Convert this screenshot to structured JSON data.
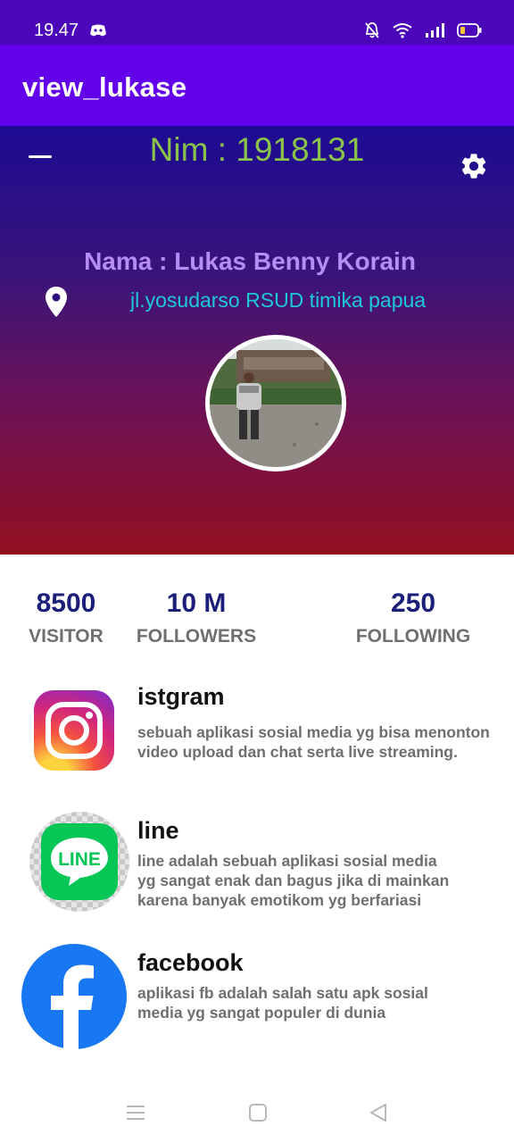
{
  "status_bar": {
    "time": "19.47",
    "icons": [
      "discord-icon",
      "silent-bell-icon",
      "wifi-icon",
      "signal-icon",
      "battery-icon"
    ]
  },
  "app_bar": {
    "title": "view_lukase"
  },
  "profile": {
    "nim": "Nim : 1918131",
    "nama": "Nama : Lukas Benny Korain",
    "alamat": "jl.yosudarso  RSUD timika papua",
    "colors": {
      "nim": "#8bc34a",
      "nama": "#b68cf5",
      "alamat": "#1fc8d6"
    }
  },
  "stats": [
    {
      "value": "8500",
      "label": "VISITOR"
    },
    {
      "value": "10 M",
      "label": "FOLLOWERS"
    },
    {
      "value": "250",
      "label": "FOLLOWING"
    }
  ],
  "apps": [
    {
      "title": "istgram",
      "icon": "instagram-icon",
      "desc": "sebuah aplikasi sosial media yg bisa menonton\nvideo upload  dan chat serta live streaming."
    },
    {
      "title": "line",
      "icon": "line-icon",
      "desc": " line adalah sebuah aplikasi sosial media\nyg sangat enak dan bagus jika di mainkan\nkarena banyak emotikom yg berfariasi"
    },
    {
      "title": "facebook",
      "icon": "facebook-icon",
      "desc": " aplikasi fb adalah salah satu apk sosial\nmedia yg sangat populer di dunia"
    }
  ],
  "theme": {
    "status_bar": "#4a06b8",
    "app_bar": "#6200ea",
    "stat_value": "#1b1f7a"
  }
}
